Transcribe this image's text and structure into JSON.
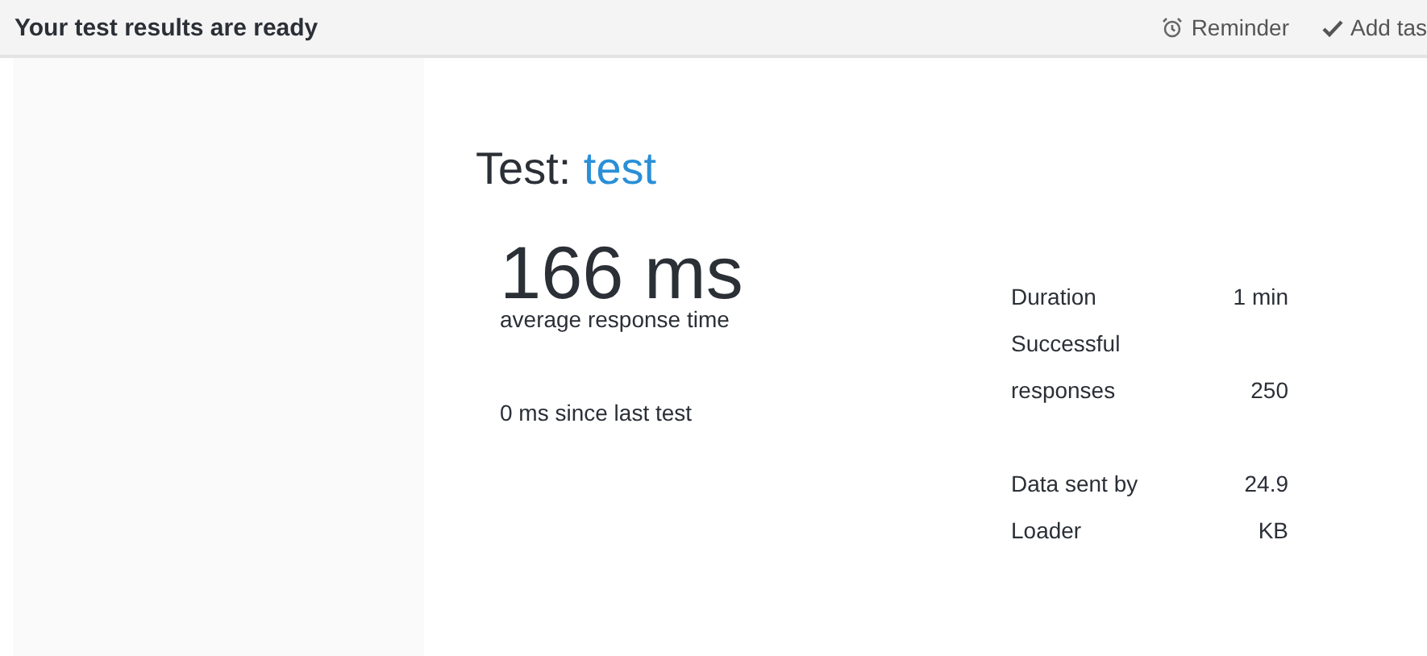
{
  "header": {
    "title": "Your test results are ready",
    "actions": [
      {
        "kind": "reminder",
        "label": "Reminder"
      },
      {
        "kind": "task",
        "label": "Add tas"
      }
    ]
  },
  "test": {
    "prefix": "Test:",
    "name": "test"
  },
  "summary": {
    "value": "166 ms",
    "caption": "average response time",
    "since": "0 ms since last test"
  },
  "stats": [
    {
      "label": "Duration",
      "value": "1 min"
    },
    {
      "label": "Successful responses",
      "value": "250"
    },
    {
      "label": "Data sent by Loader",
      "value": "24.9 KB"
    }
  ]
}
